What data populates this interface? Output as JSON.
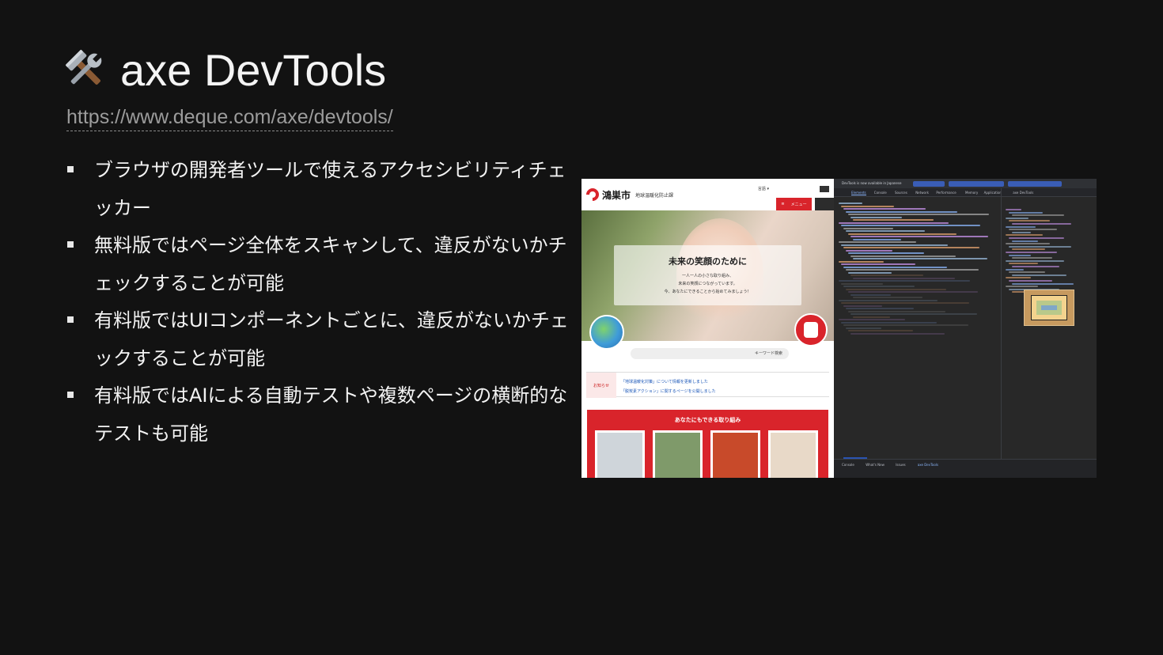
{
  "slide": {
    "title": "axe DevTools",
    "title_icon": "hammer-and-wrench-icon",
    "link": "https://www.deque.com/axe/devtools/",
    "bullets": [
      "ブラウザの開発者ツールで使えるアクセシビリティチェッカー",
      "無料版ではページ全体をスキャンして、違反がないかチェックすることが可能",
      "有料版ではUIコンポーネントごとに、違反がないかチェックすることが可能",
      "有料版ではAIによる自動テストや複数ページの横断的なテストも可能"
    ]
  },
  "screenshot": {
    "site": {
      "city_name": "鴻巣市",
      "dept": "地球温暖化防止課",
      "lang_label": "言語 ▾",
      "menu_label": "メニュー",
      "hero_title": "未来の笑顔のために",
      "hero_lines": [
        "一人一人の小さな取り組み、",
        "未来の笑顔につながっています。",
        "今、あなたにできることから始めてみましょう！"
      ],
      "search_text": "キーワード検索",
      "news_label": "お知らせ",
      "news_items": [
        "「地球温暖化対策」について情報を更新しました",
        "「脱炭素アクション」に関するページを公開しました"
      ],
      "panel_title": "あなたにもできる取り組み",
      "thumbs": [
        {
          "name": "thumb-appliance",
          "color": "#cfd5da"
        },
        {
          "name": "thumb-lunchbox",
          "color": "#7f9a6a"
        },
        {
          "name": "thumb-vegetables",
          "color": "#c84a2a"
        },
        {
          "name": "thumb-groceries",
          "color": "#e8d9c8"
        }
      ]
    },
    "devtools": {
      "top_text": "DevTools is now available in Japanese",
      "tabs": [
        "Elements",
        "Console",
        "Sources",
        "Network",
        "Performance",
        "Memory",
        "Application",
        "axe DevTools"
      ],
      "drawer_tabs": [
        "Console",
        "What's New",
        "Issues",
        "axe DevTools"
      ],
      "accent": "#8ab4f8"
    }
  }
}
